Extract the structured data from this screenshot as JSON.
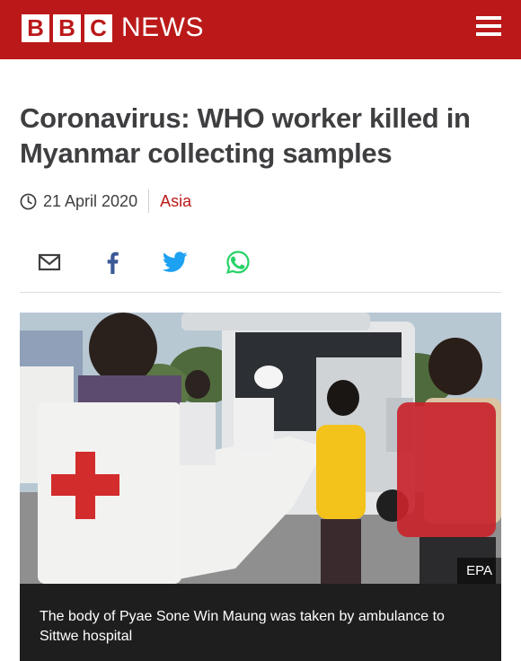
{
  "header": {
    "logo_letters": [
      "B",
      "B",
      "C"
    ],
    "logo_word": "NEWS",
    "menu_icon": "hamburger-menu-icon",
    "brand_color": "#bb1919"
  },
  "article": {
    "headline": "Coronavirus: WHO worker killed in Myanmar collecting samples",
    "date": "21 April 2020",
    "topic": "Asia"
  },
  "share": {
    "icons": [
      "email-icon",
      "facebook-icon",
      "twitter-icon",
      "whatsapp-icon"
    ]
  },
  "photo": {
    "credit": "EPA",
    "caption": "The body of Pyae Sone Win Maung was taken by ambulance to Sittwe hospital"
  }
}
